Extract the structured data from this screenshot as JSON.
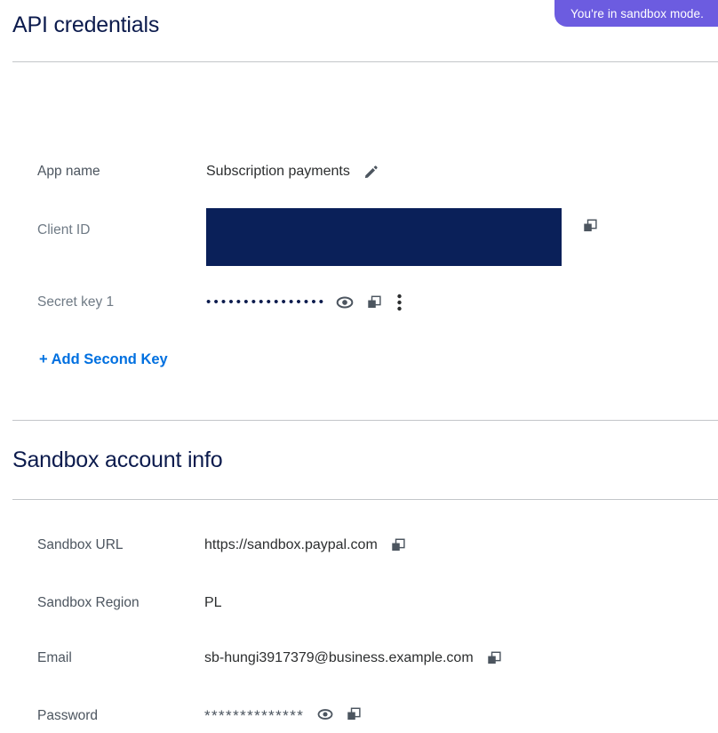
{
  "badge": {
    "text": "You're in sandbox mode.",
    "color": "#6c5ce0",
    "text_color": "#ffffff"
  },
  "api_credentials": {
    "title": "API credentials",
    "rows": {
      "app_name": {
        "label": "App name",
        "value": "Subscription payments",
        "edit_icon": "pencil-icon"
      },
      "client_id": {
        "label": "Client ID",
        "value": "",
        "redacted": true,
        "redaction_color": "#0a2059",
        "copy_icon": "copy-icon"
      },
      "secret_key": {
        "label": "Secret key 1",
        "value": "••••••••••••••••",
        "masked": true,
        "show_icon": "eye-icon",
        "copy_icon": "copy-icon",
        "menu_icon": "kebab-menu-icon"
      }
    },
    "add_second_key": "+ Add Second Key",
    "link_color": "#0070e0"
  },
  "sandbox_account_info": {
    "title": "Sandbox account info",
    "rows": [
      {
        "label": "Sandbox URL",
        "value": "https://sandbox.paypal.com",
        "copy_icon": "copy-icon"
      },
      {
        "label": "Sandbox Region",
        "value": "PL"
      },
      {
        "label": "Email",
        "value": "sb-hungi3917379@business.example.com",
        "copy_icon": "copy-icon"
      },
      {
        "label": "Password",
        "value": "**************",
        "masked": true,
        "show_icon": "eye-icon",
        "copy_icon": "copy-icon"
      }
    ]
  },
  "theme": {
    "heading_color": "#0c1b4d",
    "label_color": "#4c555f",
    "divider_color": "#c3c6c9",
    "icon_color": "#4c555f"
  }
}
